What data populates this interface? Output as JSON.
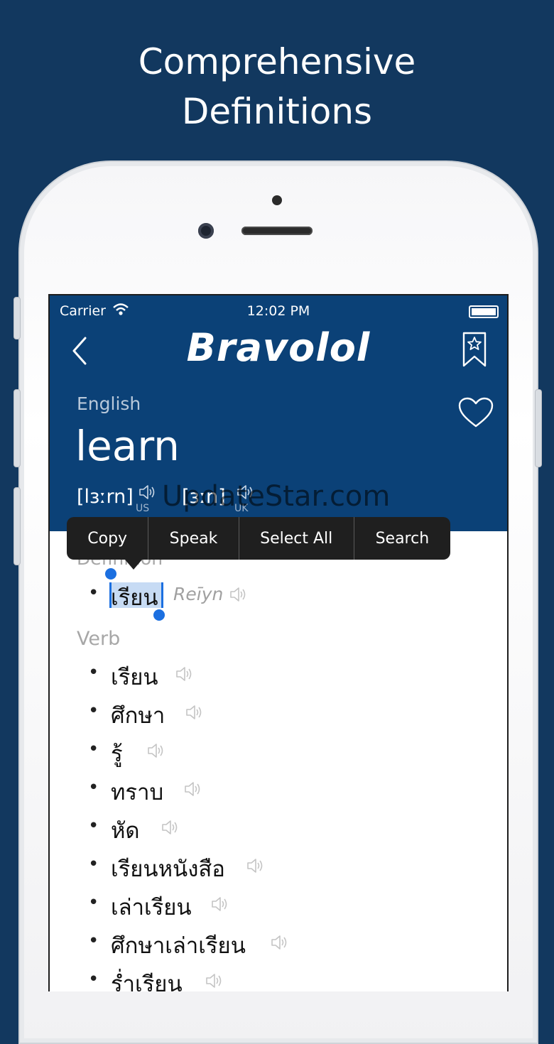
{
  "headline": {
    "line1": "Comprehensive",
    "line2": "Definitions"
  },
  "status_bar": {
    "carrier": "Carrier",
    "time": "12:02 PM"
  },
  "nav": {
    "title": "Bravolol"
  },
  "entry": {
    "language": "English",
    "word": "learn",
    "pronunciations": [
      {
        "text": "[lɜːrn]",
        "label": "US"
      },
      {
        "text": "[ɜːn]",
        "label": "UK"
      }
    ]
  },
  "context_menu": {
    "items": [
      "Copy",
      "Speak",
      "Select All",
      "Search"
    ]
  },
  "definition": {
    "section_label": "Definition",
    "thai": "เรียน",
    "romanization": "Reīyn"
  },
  "verb": {
    "section_label": "Verb",
    "items": [
      "เรียน",
      "ศึกษา",
      "รู้",
      "ทราบ",
      "หัด",
      "เรียนหนังสือ",
      "เล่าเรียน",
      "ศึกษาเล่าเรียน",
      "ร่ำเรียน"
    ]
  },
  "watermark": "UpdateStar.com",
  "colors": {
    "background": "#12385f",
    "app_bar": "#0b4177",
    "selection": "#1b6fe0"
  }
}
